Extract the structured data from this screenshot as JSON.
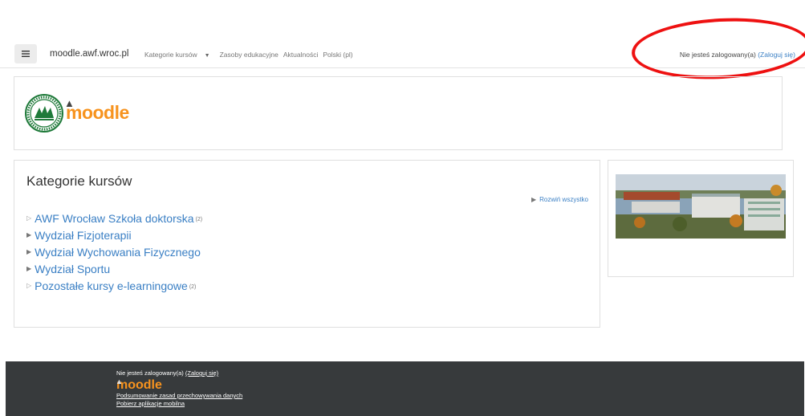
{
  "topbar": {
    "brand": "moodle.awf.wroc.pl",
    "nav": {
      "categories": "Kategorie kursów",
      "resources": "Zasoby edukacyjne",
      "news": "Aktualności",
      "language": "Polski (pl)"
    },
    "login_text": "Nie jesteś zalogowany(a)",
    "login_link": "(Zaloguj się)"
  },
  "header": {
    "moodle_logo": "moodle"
  },
  "categories": {
    "title": "Kategorie kursów",
    "expand_all": "Rozwiń wszystko",
    "items": [
      {
        "name": "AWF Wrocław Szkoła doktorska",
        "count": "(2)"
      },
      {
        "name": "Wydział Fizjoterapii",
        "count": ""
      },
      {
        "name": "Wydział Wychowania Fizycznego",
        "count": ""
      },
      {
        "name": "Wydział Sportu",
        "count": ""
      },
      {
        "name": "Pozostałe kursy e-learningowe",
        "count": "(2)"
      }
    ]
  },
  "footer": {
    "login_text": "Nie jesteś zalogowany(a)",
    "login_link": "(Zaloguj się)",
    "logo": "moodle",
    "data_retention": "Podsumowanie zasad przechowywania danych",
    "mobile_app": "Pobierz aplikacje mobilna"
  },
  "colors": {
    "link": "#3a7fc4",
    "moodle_orange": "#f7931e",
    "footer_bg": "#373a3c",
    "annotation_red": "#ee1111"
  }
}
